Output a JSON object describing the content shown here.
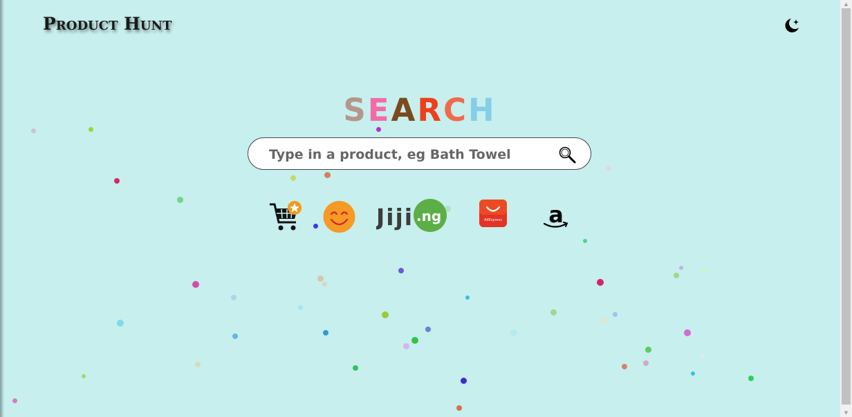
{
  "header": {
    "brand": "Product Hunt",
    "theme_toggle_icon": "moon-star-icon"
  },
  "search": {
    "title_letters": [
      {
        "char": "S",
        "color": "#b5968a"
      },
      {
        "char": "E",
        "color": "#f46aa8"
      },
      {
        "char": "A",
        "color": "#7a4a1e"
      },
      {
        "char": "R",
        "color": "#ee3f1a"
      },
      {
        "char": "C",
        "color": "#f06a4a"
      },
      {
        "char": "H",
        "color": "#86cde8"
      }
    ],
    "placeholder": "Type in a product, eg Bath Towel",
    "button_icon": "magnifier-icon"
  },
  "stores": [
    {
      "name": "cart-store",
      "icon": "shopping-cart-star-icon"
    },
    {
      "name": "smiley-store",
      "icon": "orange-smiley-icon"
    },
    {
      "name": "jiji",
      "logo_text": "Jiji",
      "logo_badge": ".ng"
    },
    {
      "name": "aliexpress",
      "logo_text": "AliExpress"
    },
    {
      "name": "amazon",
      "logo_text": "a"
    }
  ],
  "colors": {
    "background": "#c6efee"
  }
}
